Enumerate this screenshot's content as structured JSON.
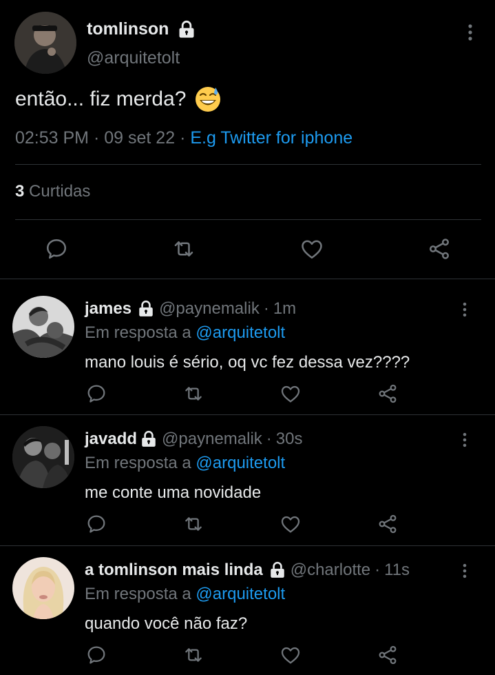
{
  "main_tweet": {
    "name": "tomlinson",
    "handle": "@arquitetolt",
    "text": "então... fiz merda?",
    "emoji": "😅",
    "time": "02:53 PM",
    "sep": "·",
    "date": "09 set 22",
    "source": "E.g Twitter for iphone",
    "likes_count": "3",
    "likes_label": "Curtidas"
  },
  "replies": [
    {
      "name": "james",
      "handle": "@paynemalik",
      "dot": "·",
      "time": "1m",
      "in_reply_prefix": "Em resposta a",
      "mention": "@arquitetolt",
      "text": "mano louis é sério, oq vc fez dessa vez????"
    },
    {
      "name": "javadd",
      "handle": "@paynemalik",
      "dot": "·",
      "time": "30s",
      "in_reply_prefix": "Em resposta a",
      "mention": "@arquitetolt",
      "text": "me conte uma novidade"
    },
    {
      "name": "a tomlinson mais linda",
      "handle": "@charlotte",
      "dot": "·",
      "time": "11s",
      "in_reply_prefix": "Em resposta a",
      "mention": "@arquitetolt",
      "text": "quando você não faz?"
    }
  ],
  "colors": {
    "background": "#000000",
    "text": "#e7e9ea",
    "muted": "#71767b",
    "accent": "#1d9bf0",
    "divider": "#2f3336"
  },
  "icons": [
    "lock-icon",
    "more-icon",
    "reply-icon",
    "retweet-icon",
    "like-icon",
    "share-icon"
  ]
}
